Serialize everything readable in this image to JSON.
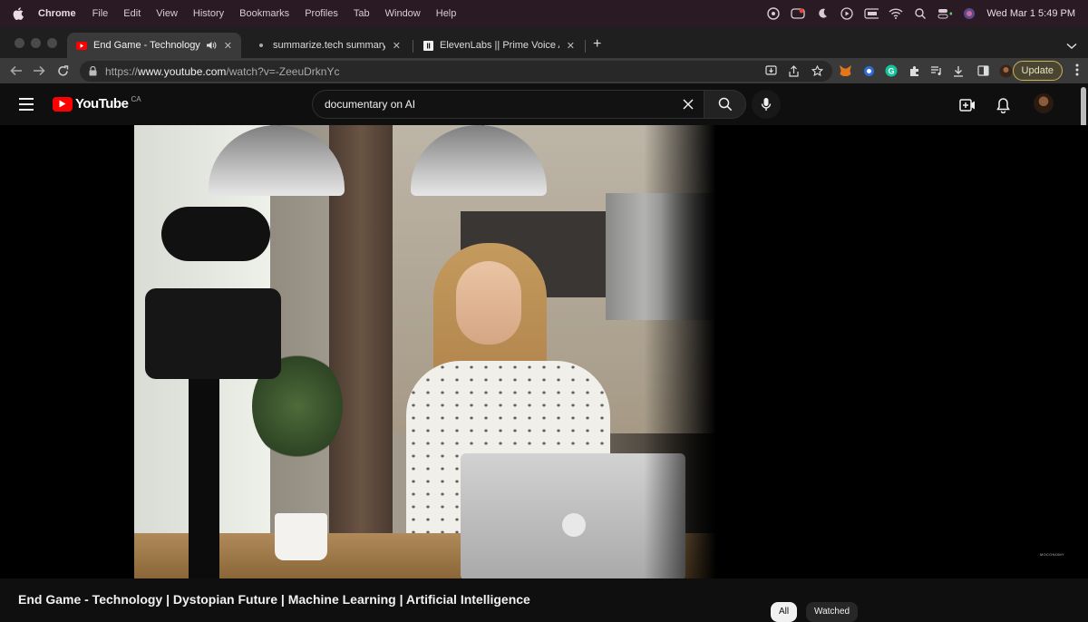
{
  "menubar": {
    "app_name": "Chrome",
    "items": [
      "File",
      "Edit",
      "View",
      "History",
      "Bookmarks",
      "Profiles",
      "Tab",
      "Window",
      "Help"
    ],
    "clock": "Wed Mar 1  5:49 PM"
  },
  "tabs": [
    {
      "label": "End Game - Technology | D",
      "favicon": "youtube-icon",
      "active": true
    },
    {
      "label": "summarize.tech summary for: E",
      "favicon": "dot-icon",
      "active": false
    },
    {
      "label": "ElevenLabs || Prime Voice AI",
      "favicon": "elevenlabs-icon",
      "active": false
    }
  ],
  "address_bar": {
    "url_prefix": "https://",
    "url_host": "www.youtube.com",
    "url_path": "/watch?v=-ZeeuDrknYc"
  },
  "toolbar": {
    "update_label": "Update"
  },
  "youtube": {
    "logo_text": "YouTube",
    "country_code": "CA",
    "search_value": "documentary on AI"
  },
  "video": {
    "title": "End Game - Technology | Dystopian Future | Machine Learning | Artificial Intelligence",
    "watermark": "MOCONOMY"
  },
  "chips": [
    "All",
    "Watched"
  ],
  "colors": {
    "youtube_red": "#ff0000",
    "page_bg": "#0f0f0f",
    "menubar_bg": "#2a1a24",
    "update_border": "#c9b458"
  }
}
